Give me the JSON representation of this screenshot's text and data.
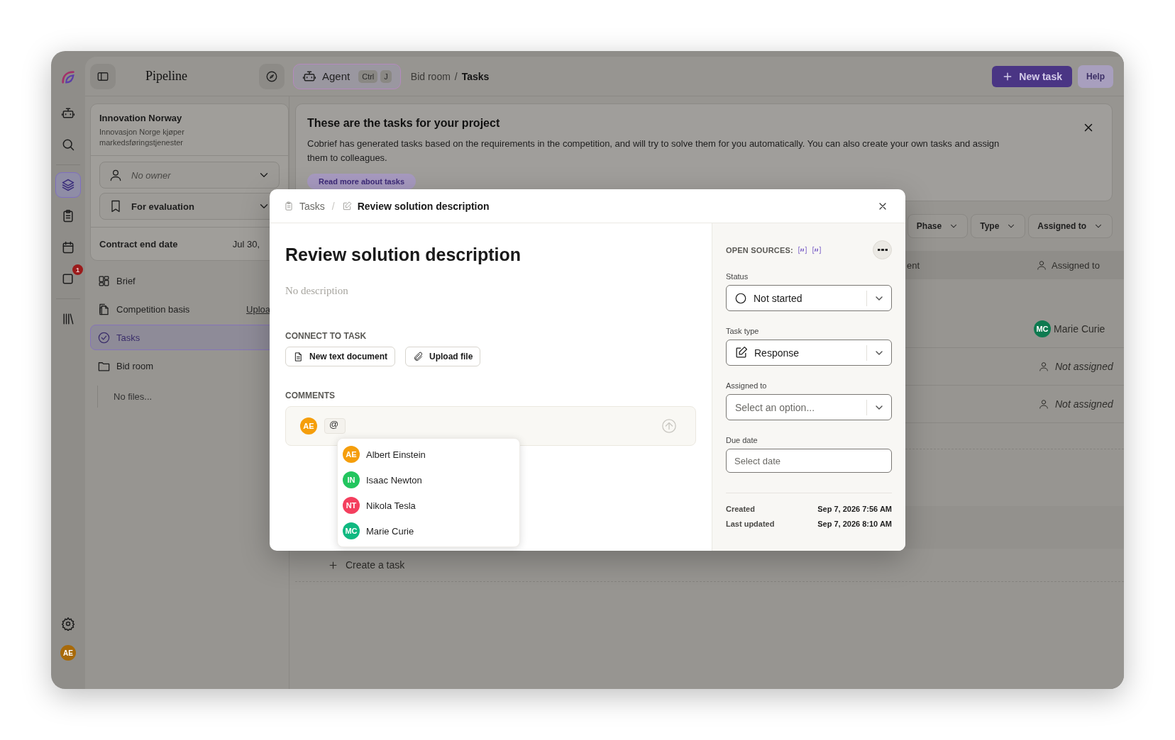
{
  "rail": {
    "items": [
      {
        "selected": false
      },
      {
        "selected": false
      },
      {
        "selected": true
      },
      {
        "selected": false
      },
      {
        "selected": false
      },
      {
        "selected": false,
        "badge": "1"
      },
      {
        "selected": false
      }
    ],
    "user": {
      "initials": "AE",
      "color": "#a86a0a"
    }
  },
  "topbar": {
    "title": "Pipeline",
    "agent": {
      "label": "Agent",
      "keys": [
        "Ctrl",
        "J"
      ]
    },
    "breadcrumb": [
      {
        "label": "Bid room",
        "current": false
      },
      {
        "label": "Tasks",
        "current": true
      }
    ],
    "breadcrumb_separator": "/",
    "new_task": "New task",
    "help": "Help"
  },
  "project": {
    "name": "Innovation Norway",
    "subtitle": "Innovasjon Norge kjøper markedsføringstjenester",
    "owner": {
      "placeholder": "No owner"
    },
    "phase": {
      "value": "For evaluation"
    },
    "contract_end": {
      "label": "Contract end date",
      "value": "Jul 30,"
    }
  },
  "nav": [
    {
      "label": "Brief",
      "selected": false
    },
    {
      "label": "Competition basis",
      "action": "Uploa",
      "selected": false
    },
    {
      "label": "Tasks",
      "selected": true
    },
    {
      "label": "Bid room",
      "selected": false
    }
  ],
  "bid_room_files": "No files...",
  "banner": {
    "title": "These are the tasks for your project",
    "text": "Cobrief has generated tasks based on the requirements in the competition, and will try to solve them for you automatically. You can also create your own tasks and assign them to colleagues.",
    "link": "Read more about tasks"
  },
  "filters": [
    {
      "label": "Phase"
    },
    {
      "label": "Type"
    },
    {
      "label": "Assigned to"
    }
  ],
  "table": {
    "columns": [
      "ent",
      "Assigned to"
    ],
    "rows": [
      {
        "kind": "empty"
      },
      {
        "kind": "person",
        "initials": "MC",
        "name": "Marie Curie",
        "color": "#0e7a50"
      },
      {
        "kind": "none",
        "name": "Not assigned"
      },
      {
        "kind": "none",
        "name": "Not assigned"
      }
    ]
  },
  "create_task": "Create a task",
  "modal": {
    "breadcrumb": [
      "Tasks",
      "Review solution description"
    ],
    "breadcrumb_separator": "/",
    "title": "Review solution description",
    "description_placeholder": "No description",
    "connect_label": "CONNECT TO TASK",
    "actions": [
      "New text document",
      "Upload file"
    ],
    "comments_label": "COMMENTS",
    "composer": {
      "initials": "AE",
      "color": "#f59e0b",
      "value": "@"
    },
    "mentions": [
      {
        "initials": "AE",
        "name": "Albert Einstein",
        "color": "#f59e0b"
      },
      {
        "initials": "IN",
        "name": "Isaac Newton",
        "color": "#22c55e"
      },
      {
        "initials": "NT",
        "name": "Nikola Tesla",
        "color": "#f43f5e"
      },
      {
        "initials": "MC",
        "name": "Marie Curie",
        "color": "#10b981"
      }
    ],
    "sources_label": "OPEN SOURCES:",
    "fields": [
      {
        "label": "Status",
        "kind": "status",
        "value": "Not started"
      },
      {
        "label": "Task type",
        "kind": "type",
        "value": "Response"
      },
      {
        "label": "Assigned to",
        "kind": "person",
        "placeholder": "Select an option..."
      },
      {
        "label": "Due date",
        "kind": "date",
        "placeholder": "Select date"
      }
    ],
    "meta": [
      {
        "label": "Created",
        "value": "Sep 7, 2026 7:56 AM"
      },
      {
        "label": "Last updated",
        "value": "Sep 7, 2026 8:10 AM"
      }
    ]
  }
}
